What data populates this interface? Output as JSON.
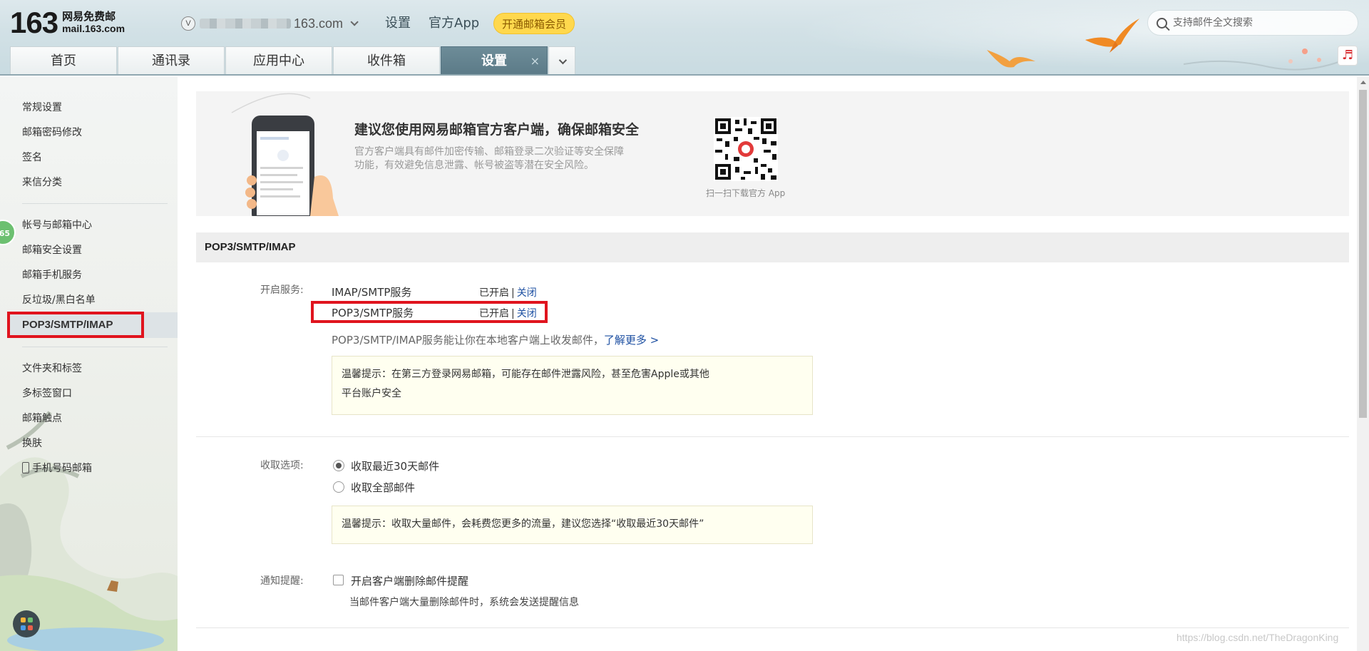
{
  "header": {
    "logo_number": "163",
    "logo_cn": "网易免费邮",
    "logo_en": "mail.163.com",
    "account_badge": "V",
    "account_domain": "163.com",
    "links": {
      "settings": "设置",
      "official_app": "官方App"
    },
    "vip_button": "开通邮箱会员",
    "search_placeholder": "支持邮件全文搜索",
    "music_icon": "♬"
  },
  "tabs": [
    {
      "label": "首页"
    },
    {
      "label": "通讯录"
    },
    {
      "label": "应用中心"
    },
    {
      "label": "收件箱"
    },
    {
      "label": "设置",
      "active": true,
      "close": "×"
    }
  ],
  "sidebar": {
    "group1": [
      "常规设置",
      "邮箱密码修改",
      "签名",
      "来信分类"
    ],
    "group2": [
      "帐号与邮箱中心",
      "邮箱安全设置",
      "邮箱手机服务",
      "反垃圾/黑白名单",
      "POP3/SMTP/IMAP"
    ],
    "group3": [
      "文件夹和标签",
      "多标签窗口",
      "邮箱触点",
      "换肤",
      "手机号码邮箱"
    ],
    "active_item": "POP3/SMTP/IMAP",
    "badge": "65"
  },
  "banner": {
    "title": "建议您使用网易邮箱官方客户端，确保邮箱安全",
    "desc": "官方客户端具有邮件加密传输、邮箱登录二次验证等安全保障功能，有效避免信息泄露、帐号被盗等潜在安全风险。",
    "qr_caption": "扫一扫下载官方 App"
  },
  "section": {
    "title": "POP3/SMTP/IMAP",
    "service_label": "开启服务:",
    "services": [
      {
        "name": "IMAP/SMTP服务",
        "status": "已开启",
        "action": "关闭"
      },
      {
        "name": "POP3/SMTP服务",
        "status": "已开启",
        "action": "关闭"
      }
    ],
    "hint": "POP3/SMTP/IMAP服务能让你在本地客户端上收发邮件，",
    "hint_link": "了解更多 >",
    "tip1_line1": "温馨提示：在第三方登录网易邮箱，可能存在邮件泄露风险，甚至危害Apple或其他",
    "tip1_line2": "平台账户安全",
    "receive_label": "收取选项:",
    "receive_options": [
      {
        "label": "收取最近30天邮件",
        "selected": true
      },
      {
        "label": "收取全部邮件",
        "selected": false
      }
    ],
    "tip2": "温馨提示：收取大量邮件，会耗费您更多的流量，建议您选择“收取最近30天邮件”",
    "notify_label": "通知提醒:",
    "notify_option": "开启客户端删除邮件提醒",
    "notify_checked": false,
    "notify_note": "当邮件客户端大量删除邮件时，系统会发送提醒信息"
  },
  "watermark": "https://blog.csdn.net/TheDragonKing",
  "colors": {
    "accent_red": "#e0141e",
    "link_blue": "#1e50a2",
    "tab_active": "#5b7a87",
    "vip_yellow": "#ffd84d"
  }
}
